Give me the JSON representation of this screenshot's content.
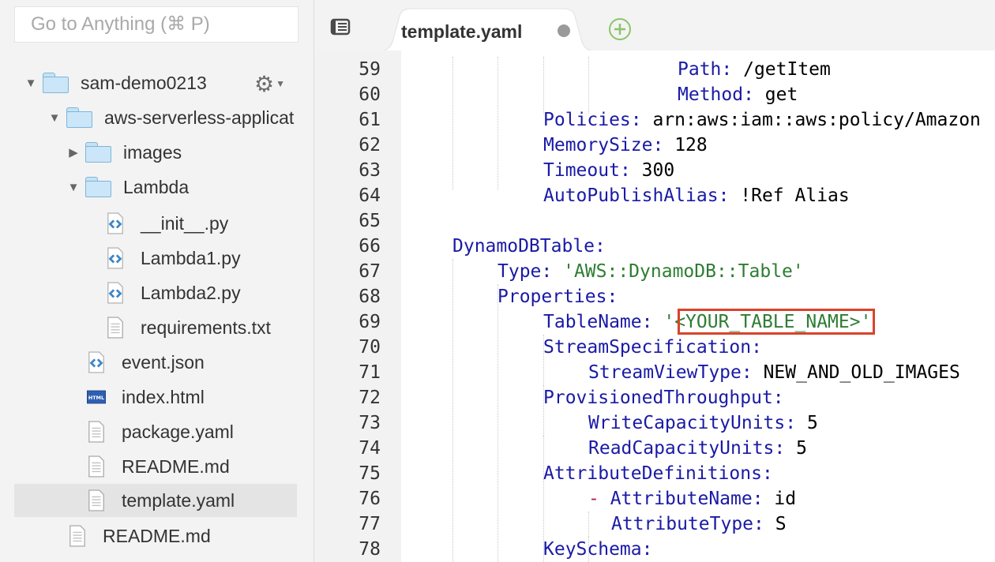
{
  "sidebar": {
    "search_placeholder": "Go to Anything (⌘ P)",
    "tree": [
      {
        "label": "sam-demo0213",
        "type": "folder",
        "state": "expanded"
      },
      {
        "label": "aws-serverless-applicat",
        "type": "folder",
        "state": "expanded"
      },
      {
        "label": "images",
        "type": "folder",
        "state": "collapsed"
      },
      {
        "label": "Lambda",
        "type": "folder",
        "state": "expanded"
      },
      {
        "label": "__init__.py",
        "type": "code-file"
      },
      {
        "label": "Lambda1.py",
        "type": "code-file"
      },
      {
        "label": "Lambda2.py",
        "type": "code-file"
      },
      {
        "label": "requirements.txt",
        "type": "text-file"
      },
      {
        "label": "event.json",
        "type": "code-file"
      },
      {
        "label": "index.html",
        "type": "html-file"
      },
      {
        "label": "package.yaml",
        "type": "text-file"
      },
      {
        "label": "README.md",
        "type": "text-file"
      },
      {
        "label": "template.yaml",
        "type": "text-file",
        "selected": true
      },
      {
        "label": "README.md",
        "type": "text-file"
      }
    ],
    "html_badge": "HTML"
  },
  "tabs": {
    "active_title": "template.yaml",
    "unsaved_indicator": "dot",
    "add_icon": "plus-circle-icon",
    "menu_icon": "tab-menu-icon"
  },
  "editor": {
    "lines": [
      {
        "n": "59",
        "key": "Path",
        "sep": ": ",
        "val": "/getItem"
      },
      {
        "n": "60",
        "key": "Method",
        "sep": ": ",
        "val": "get"
      },
      {
        "n": "61",
        "key": "Policies",
        "sep": ": ",
        "val": "arn:aws:iam::aws:policy/Amazon"
      },
      {
        "n": "62",
        "key": "MemorySize",
        "sep": ": ",
        "val": "128"
      },
      {
        "n": "63",
        "key": "Timeout",
        "sep": ": ",
        "val": "300"
      },
      {
        "n": "64",
        "key": "AutoPublishAlias",
        "sep": ": ",
        "val": "!Ref Alias"
      },
      {
        "n": "65"
      },
      {
        "n": "66",
        "key": "DynamoDBTable",
        "sep": ":"
      },
      {
        "n": "67",
        "key": "Type",
        "sep": ": ",
        "val": "'AWS::DynamoDB::Table'"
      },
      {
        "n": "68",
        "key": "Properties",
        "sep": ":"
      },
      {
        "n": "69",
        "key": "TableName",
        "sep": ": ",
        "quote_open": "'",
        "val": "<YOUR_TABLE_NAME>",
        "quote_close": "'"
      },
      {
        "n": "70",
        "key": "StreamSpecification",
        "sep": ":"
      },
      {
        "n": "71",
        "key": "StreamViewType",
        "sep": ": ",
        "val": "NEW_AND_OLD_IMAGES"
      },
      {
        "n": "72",
        "key": "ProvisionedThroughput",
        "sep": ":"
      },
      {
        "n": "73",
        "key": "WriteCapacityUnits",
        "sep": ": ",
        "val": "5"
      },
      {
        "n": "74",
        "key": "ReadCapacityUnits",
        "sep": ": ",
        "val": "5"
      },
      {
        "n": "75",
        "key": "AttributeDefinitions",
        "sep": ":"
      },
      {
        "n": "76",
        "dash": "- ",
        "key": "AttributeName",
        "sep": ": ",
        "val": "id"
      },
      {
        "n": "77",
        "key": "AttributeType",
        "sep": ": ",
        "val": "S"
      },
      {
        "n": "78",
        "key": "KeySchema",
        "sep": ":"
      }
    ]
  },
  "colors": {
    "key": "#1a1aa6",
    "string": "#2e7d32",
    "dash": "#b51f5a",
    "highlight_border": "#d9432b"
  }
}
